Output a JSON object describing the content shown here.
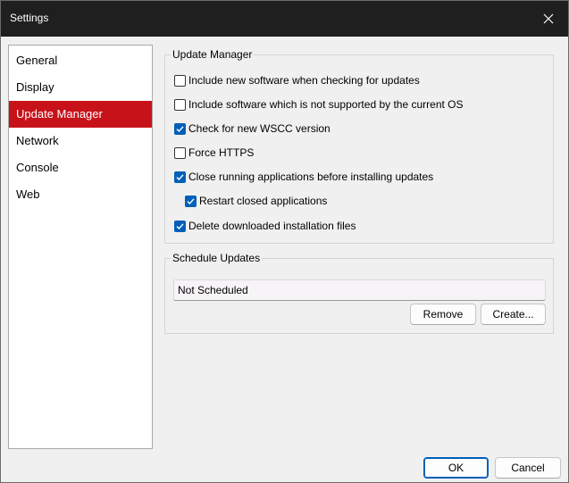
{
  "window": {
    "title": "Settings"
  },
  "icons": {
    "close": "close-icon",
    "check": "checkmark-icon"
  },
  "colors": {
    "nav_active": "#c8121a",
    "checkbox_checked": "#005fb8",
    "titlebar": "#1f1f1f"
  },
  "sidebar": {
    "selected": "Update Manager",
    "items": [
      {
        "label": "General"
      },
      {
        "label": "Display"
      },
      {
        "label": "Update Manager"
      },
      {
        "label": "Network"
      },
      {
        "label": "Console"
      },
      {
        "label": "Web"
      }
    ]
  },
  "update_manager": {
    "legend": "Update Manager",
    "options": [
      {
        "label": "Include new software when checking for updates",
        "checked": false
      },
      {
        "label": "Include software which is not supported by the current OS",
        "checked": false
      },
      {
        "label": "Check for new WSCC version",
        "checked": true
      },
      {
        "label": "Force HTTPS",
        "checked": false
      },
      {
        "label": "Close running applications before installing updates",
        "checked": true
      },
      {
        "label": "Restart closed applications",
        "checked": true
      },
      {
        "label": "Delete downloaded installation files",
        "checked": true
      }
    ]
  },
  "schedule": {
    "legend": "Schedule Updates",
    "value": "Not Scheduled",
    "remove_label": "Remove",
    "create_label": "Create..."
  },
  "footer": {
    "ok_label": "OK",
    "cancel_label": "Cancel"
  }
}
